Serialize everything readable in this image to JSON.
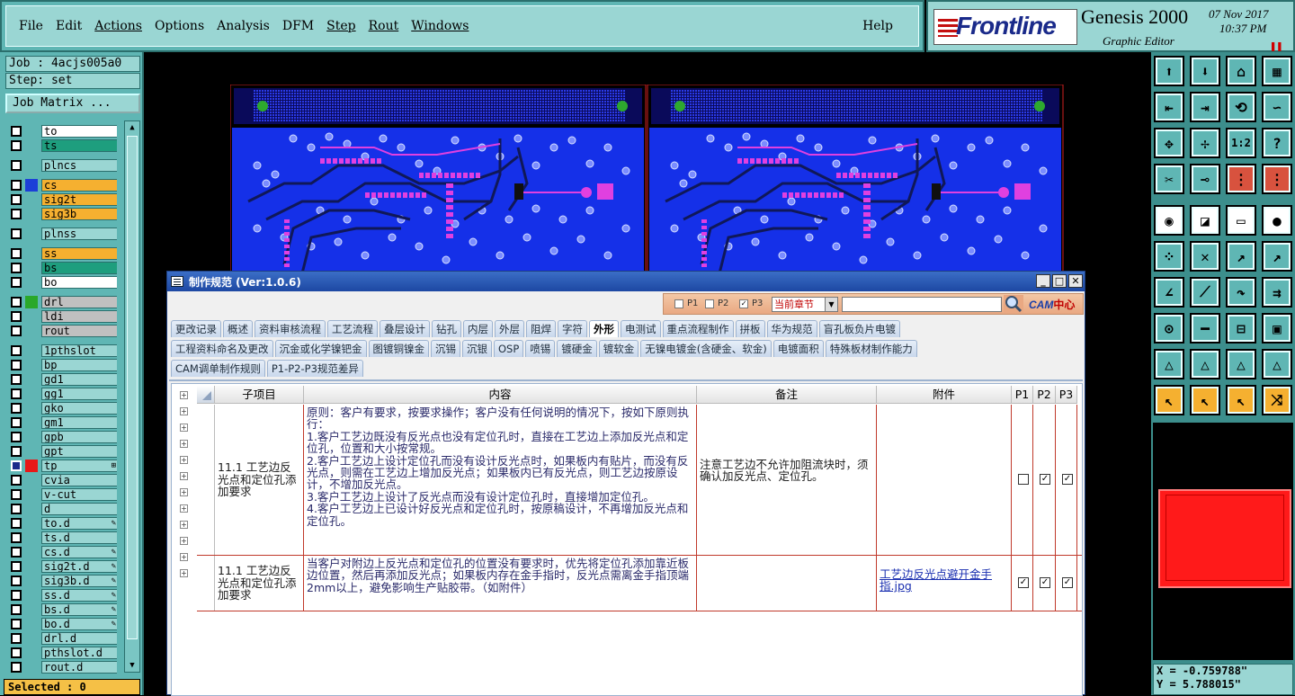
{
  "menubar": {
    "items": [
      "File",
      "Edit",
      "Actions",
      "Options",
      "Analysis",
      "DFM",
      "Step",
      "Rout",
      "Windows"
    ],
    "help": "Help"
  },
  "brand": {
    "logo": "Frontline",
    "product": "Genesis 2000",
    "subtitle": "Graphic Editor",
    "date": "07 Nov 2017",
    "time": "10:37 PM"
  },
  "leftpanel": {
    "job": "Job : 4acjs005a0",
    "step": "Step: set",
    "job_matrix": "Job Matrix ...",
    "selected": "Selected : 0",
    "layers": [
      {
        "name": "to",
        "bg": "#ffffff",
        "swatch": "",
        "group": 0
      },
      {
        "name": "ts",
        "bg": "#1e9e7e",
        "swatch": "",
        "group": 0
      },
      {
        "name": "plncs",
        "bg": "#9ad6d3",
        "swatch": "",
        "group": 1
      },
      {
        "name": "cs",
        "bg": "#f5b030",
        "swatch": "#1c3fd8",
        "group": 2
      },
      {
        "name": "sig2t",
        "bg": "#f5b030",
        "swatch": "",
        "group": 2
      },
      {
        "name": "sig3b",
        "bg": "#f5b030",
        "swatch": "",
        "group": 2
      },
      {
        "name": "plnss",
        "bg": "#9ad6d3",
        "swatch": "",
        "group": 3
      },
      {
        "name": "ss",
        "bg": "#f5b030",
        "swatch": "",
        "group": 4
      },
      {
        "name": "bs",
        "bg": "#1e9e7e",
        "swatch": "",
        "group": 4
      },
      {
        "name": "bo",
        "bg": "#ffffff",
        "swatch": "",
        "group": 4
      },
      {
        "name": "drl",
        "bg": "#c0c0c0",
        "swatch": "#2aa82a",
        "group": 5
      },
      {
        "name": "ldi",
        "bg": "#c0c0c0",
        "swatch": "",
        "group": 5
      },
      {
        "name": "rout",
        "bg": "#c0c0c0",
        "swatch": "",
        "group": 5
      },
      {
        "name": "1pthslot",
        "bg": "#9ad6d3",
        "swatch": "",
        "group": 6
      },
      {
        "name": "bp",
        "bg": "#9ad6d3",
        "swatch": "",
        "group": 6
      },
      {
        "name": "gd1",
        "bg": "#9ad6d3",
        "swatch": "",
        "group": 6
      },
      {
        "name": "gg1",
        "bg": "#9ad6d3",
        "swatch": "",
        "group": 6
      },
      {
        "name": "gko",
        "bg": "#9ad6d3",
        "swatch": "",
        "group": 6
      },
      {
        "name": "gm1",
        "bg": "#9ad6d3",
        "swatch": "",
        "group": 6
      },
      {
        "name": "gpb",
        "bg": "#9ad6d3",
        "swatch": "",
        "group": 6
      },
      {
        "name": "gpt",
        "bg": "#9ad6d3",
        "swatch": "",
        "group": 6
      },
      {
        "name": "tp",
        "bg": "#9ad6d3",
        "swatch": "#e81818",
        "group": 6,
        "flag": "⊞",
        "selected": true
      },
      {
        "name": "cvia",
        "bg": "#9ad6d3",
        "swatch": "",
        "group": 6
      },
      {
        "name": "v-cut",
        "bg": "#9ad6d3",
        "swatch": "",
        "group": 6
      },
      {
        "name": "d",
        "bg": "#9ad6d3",
        "swatch": "",
        "group": 6
      },
      {
        "name": "to.d",
        "bg": "#9ad6d3",
        "swatch": "",
        "group": 6,
        "flag": "✎"
      },
      {
        "name": "ts.d",
        "bg": "#9ad6d3",
        "swatch": "",
        "group": 6
      },
      {
        "name": "cs.d",
        "bg": "#9ad6d3",
        "swatch": "",
        "group": 6,
        "flag": "✎"
      },
      {
        "name": "sig2t.d",
        "bg": "#9ad6d3",
        "swatch": "",
        "group": 6,
        "flag": "✎"
      },
      {
        "name": "sig3b.d",
        "bg": "#9ad6d3",
        "swatch": "",
        "group": 6,
        "flag": "✎"
      },
      {
        "name": "ss.d",
        "bg": "#9ad6d3",
        "swatch": "",
        "group": 6,
        "flag": "✎"
      },
      {
        "name": "bs.d",
        "bg": "#9ad6d3",
        "swatch": "",
        "group": 6,
        "flag": "✎"
      },
      {
        "name": "bo.d",
        "bg": "#9ad6d3",
        "swatch": "",
        "group": 6,
        "flag": "✎"
      },
      {
        "name": "drl.d",
        "bg": "#9ad6d3",
        "swatch": "",
        "group": 6
      },
      {
        "name": "pthslot.d",
        "bg": "#9ad6d3",
        "swatch": "",
        "group": 6
      },
      {
        "name": "rout.d",
        "bg": "#9ad6d3",
        "swatch": "",
        "group": 6
      }
    ]
  },
  "coords": {
    "x": "X = -0.759788\"",
    "y": "Y = 5.788015\""
  },
  "dialog": {
    "title": "制作规范 (Ver:1.0.6)",
    "filters": [
      {
        "label": "P1",
        "checked": false
      },
      {
        "label": "P2",
        "checked": false
      },
      {
        "label": "P3",
        "checked": true
      }
    ],
    "scope": "当前章节",
    "search_value": "",
    "cam_logo": "CAM",
    "cam_logo_suffix": "中心",
    "tabs_row1": [
      "更改记录",
      "概述",
      "资料审核流程",
      "工艺流程",
      "叠层设计",
      "钻孔",
      "内层",
      "外层",
      "阻焊",
      "字符",
      "外形",
      "电测试",
      "重点流程制作",
      "拼板",
      "华为规范",
      "盲孔板负片电镀"
    ],
    "tabs_row2": [
      "工程资料命名及更改",
      "沉金或化学镍钯金",
      "图镀铜镍金",
      "沉锡",
      "沉银",
      "OSP",
      "喷锡",
      "镀硬金",
      "镀软金",
      "无镍电镀金(含硬金、软金)",
      "电镀面积",
      "特殊板材制作能力"
    ],
    "tabs_row3": [
      "CAM调单制作规则",
      "P1-P2-P3规范差异"
    ],
    "active_tab": "外形",
    "columns": [
      "子项目",
      "内容",
      "备注",
      "附件",
      "P1",
      "P2",
      "P3"
    ],
    "rows": [
      {
        "subitem": "11.1 工艺边反光点和定位孔添加要求",
        "content": "原则：客户有要求，按要求操作；客户没有任何说明的情况下，按如下原则执行：\n1.客户工艺边既没有反光点也没有定位孔时，直接在工艺边上添加反光点和定位孔，位置和大小按常规。\n2.客户工艺边上设计定位孔而没有设计反光点时，如果板内有贴片，而没有反光点，则需在工艺边上增加反光点；如果板内已有反光点，则工艺边按原设计，不增加反光点。\n3.客户工艺边上设计了反光点而没有设计定位孔时，直接增加定位孔。\n4.客户工艺边上已设计好反光点和定位孔时，按原稿设计，不再增加反光点和定位孔。",
        "remark": "注意工艺边不允许加阻流块时，须确认加反光点、定位孔。",
        "attachment": "",
        "p1": false,
        "p2": true,
        "p3": true
      },
      {
        "subitem": "11.1 工艺边反光点和定位孔添加要求",
        "content": "当客户对附边上反光点和定位孔的位置没有要求时，优先将定位孔添加靠近板边位置，然后再添加反光点；如果板内存在金手指时，反光点需离金手指顶端2mm以上，避免影响生产贴胶带。（如附件）",
        "remark": "",
        "attachment": "工艺边反光点避开金手指.jpg",
        "p1": true,
        "p2": true,
        "p3": true
      }
    ]
  },
  "colors": {
    "teal": "#5fb6b4",
    "teal_light": "#9ad6d3",
    "pcb_blue": "#1530e8",
    "pcb_magenta": "#e040e0",
    "titlebar": "#1d48a3",
    "grid_red": "#c0392b"
  }
}
